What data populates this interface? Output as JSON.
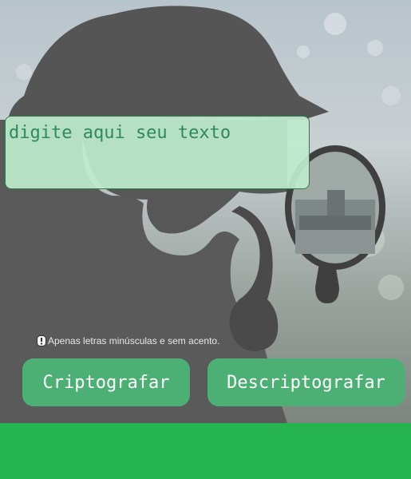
{
  "input": {
    "placeholder": "digite aqui seu texto"
  },
  "hint": {
    "icon": "info-exclamation-icon",
    "text": "Apenas letras minúsculas e sem acento."
  },
  "buttons": {
    "encrypt_label": "Criptografar",
    "decrypt_label": "Descriptografar"
  },
  "colors": {
    "button": "#4caf74",
    "footer": "#25b450",
    "input_bg": "#beebcd",
    "input_text": "#2f8a57"
  }
}
